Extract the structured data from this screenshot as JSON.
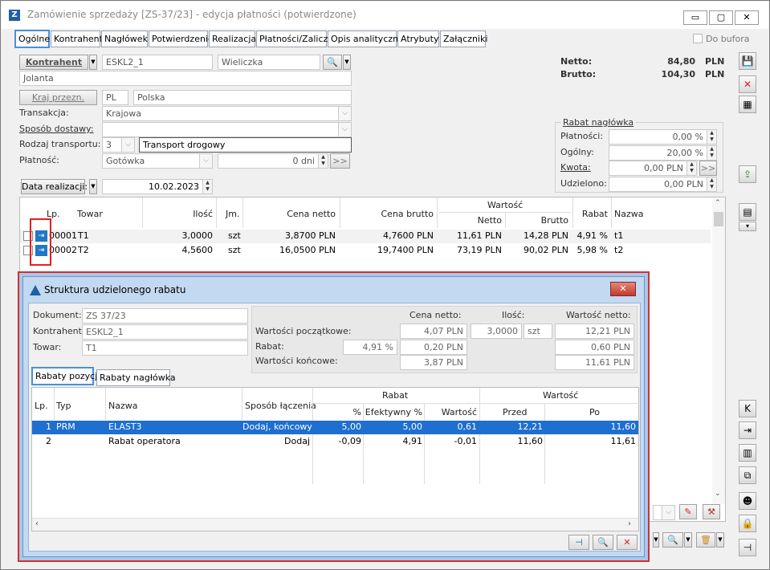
{
  "window": {
    "title": "Zamówienie sprzedaży [ZS-37/23] - edycja płatności  (potwierdzone)",
    "app_icon": "Z"
  },
  "tabs": [
    "Ogólne",
    "Kontrahent",
    "Nagłówek",
    "Potwierdzenie",
    "Realizacja",
    "Płatności/Zaliczki",
    "Opis analityczny",
    "Atrybuty",
    "Załączniki"
  ],
  "do_bufora_label": "Do bufora",
  "kontrahent": {
    "button": "Kontrahent",
    "code": "ESKL2_1",
    "city": "Wieliczka",
    "name": "Jolanta"
  },
  "kraj": {
    "button": "Kraj przezn.",
    "code": "PL",
    "name": "Polska"
  },
  "transakcja": {
    "label": "Transakcja:",
    "value": "Krajowa"
  },
  "sposob_dostawy": {
    "label": "Sposób dostawy:",
    "value": ""
  },
  "rodzaj_transportu": {
    "label": "Rodzaj transportu:",
    "code": "3",
    "value": "Transport drogowy"
  },
  "platnosc": {
    "label": "Płatność:",
    "value": "Gotówka",
    "days": "0 dni",
    "more": ">>"
  },
  "data_realizacji": {
    "button": "Data realizacji:",
    "value": "10.02.2023"
  },
  "totals": {
    "netto_label": "Netto:",
    "netto": "84,80",
    "brutto_label": "Brutto:",
    "brutto": "104,30",
    "currency": "PLN"
  },
  "rabat_naglowka": {
    "title": "Rabat nagłówka",
    "platnosci_label": "Płatności:",
    "platnosci": "0,00 %",
    "ogolny_label": "Ogólny:",
    "ogolny": "20,00 %",
    "kwota_label": "Kwota:",
    "kwota": "0,00 PLN",
    "kwota_btn": ">>",
    "udzielono_label": "Udzielono:",
    "udzielono": "0,00 PLN"
  },
  "items_grid": {
    "headers": {
      "lp": "Lp.",
      "towar": "Towar",
      "ilosc": "Ilość",
      "jm": "Jm.",
      "cena_netto": "Cena netto",
      "cena_brutto": "Cena brutto",
      "wartosc": "Wartość",
      "netto": "Netto",
      "brutto": "Brutto",
      "rabat": "Rabat",
      "nazwa": "Nazwa"
    },
    "rows": [
      {
        "lp": "00001",
        "towar": "T1",
        "ilosc": "3,0000",
        "jm": "szt",
        "cena_netto": "3,8700 PLN",
        "cena_brutto": "4,7600 PLN",
        "netto": "11,61 PLN",
        "brutto": "14,28 PLN",
        "rabat": "4,91 %",
        "nazwa": "t1"
      },
      {
        "lp": "00002",
        "towar": "T2",
        "ilosc": "4,5600",
        "jm": "szt",
        "cena_netto": "16,0500 PLN",
        "cena_brutto": "19,7400 PLN",
        "netto": "73,19 PLN",
        "brutto": "90,02 PLN",
        "rabat": "5,98 %",
        "nazwa": "t2"
      }
    ]
  },
  "dialog": {
    "title": "Struktura udzielonego rabatu",
    "dokument_label": "Dokument:",
    "dokument": "ZS 37/23",
    "kontrahent_label": "Kontrahent:",
    "kontrahent": "ESKL2_1",
    "towar_label": "Towar:",
    "towar": "T1",
    "col_cena_netto": "Cena netto:",
    "col_ilosc": "Ilość:",
    "col_wartosc_netto": "Wartość netto:",
    "wartosci_poczatkowe_label": "Wartości początkowe:",
    "wp_cena": "4,07 PLN",
    "wp_ilosc": "3,0000",
    "wp_jm": "szt",
    "wp_wartosc": "12,21 PLN",
    "rabat_label": "Rabat:",
    "rabat_pct": "4,91 %",
    "rabat_cena": "0,20 PLN",
    "rabat_wartosc": "0,60 PLN",
    "wartosci_koncowe_label": "Wartości końcowe:",
    "wk_cena": "3,87 PLN",
    "wk_wartosc": "11,61 PLN",
    "tabs": [
      "Rabaty pozycji",
      "Rabaty nagłówka"
    ],
    "grid_headers": {
      "lp": "Lp.",
      "typ": "Typ",
      "nazwa": "Nazwa",
      "sposob": "Sposób łączenia",
      "rabat": "Rabat",
      "pct": "%",
      "efektywny": "Efektywny %",
      "wartosc_r": "Wartość",
      "wartosc": "Wartość",
      "przed": "Przed",
      "po": "Po"
    },
    "rows": [
      {
        "lp": "1",
        "typ": "PRM",
        "nazwa": "ELAST3",
        "sposob": "Dodaj, końcowy",
        "pct": "5,00",
        "efektywny": "5,00",
        "wartosc_r": "0,61",
        "przed": "12,21",
        "po": "11,60"
      },
      {
        "lp": "2",
        "typ": "",
        "nazwa": "Rabat operatora",
        "sposob": "Dodaj",
        "pct": "-0,09",
        "efektywny": "4,91",
        "wartosc_r": "-0,01",
        "przed": "11,60",
        "po": "11,61"
      }
    ]
  },
  "colors": {
    "accent": "#1e6fcf",
    "highlight_border": "#e02020"
  }
}
